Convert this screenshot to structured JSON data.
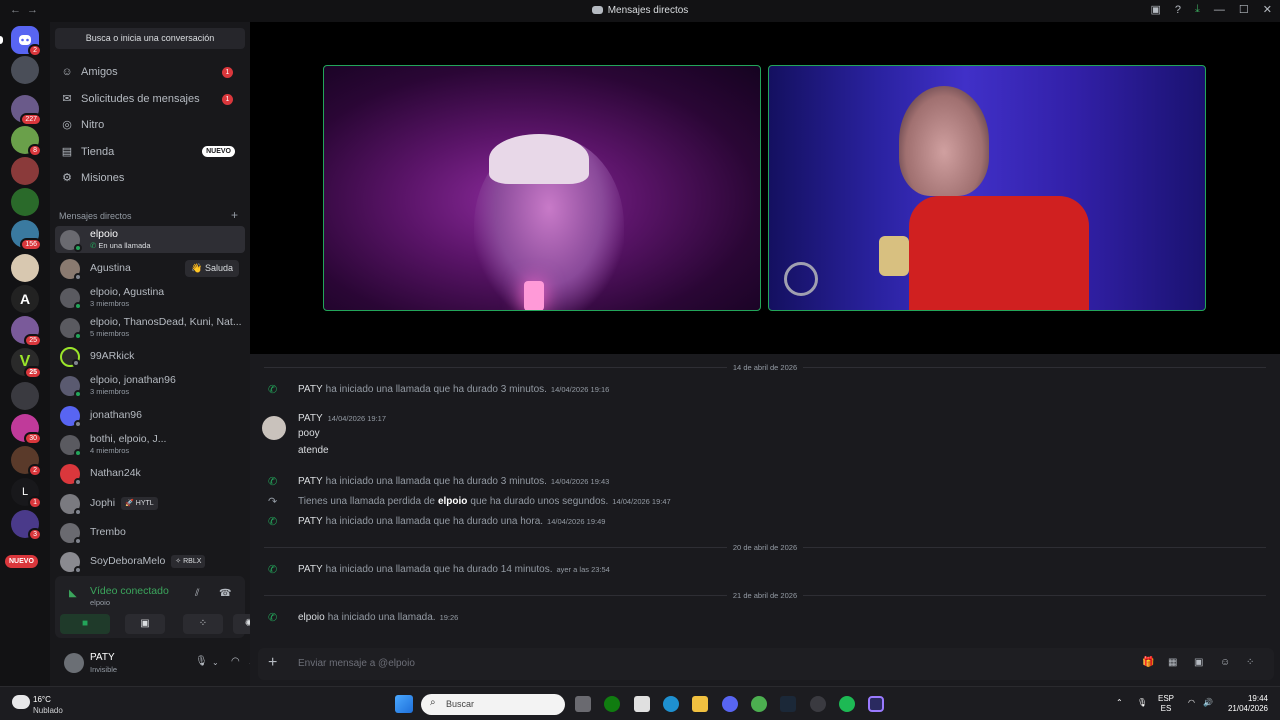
{
  "window": {
    "title": "Mensajes directos"
  },
  "search": {
    "label": "Busca o inicia una conversación"
  },
  "guild_badges": [
    "2",
    "227",
    "8",
    "156",
    "25",
    "25",
    "30",
    "2",
    "1",
    "3"
  ],
  "guild_new_label": "NUEVO",
  "nav": {
    "friends": {
      "label": "Amigos",
      "badge": "1"
    },
    "requests": {
      "label": "Solicitudes de mensajes",
      "badge": "1"
    },
    "nitro": {
      "label": "Nitro"
    },
    "shop": {
      "label": "Tienda",
      "badge": "NUEVO"
    },
    "quests": {
      "label": "Misiones"
    }
  },
  "dm_header": "Mensajes directos",
  "dms": [
    {
      "name": "elpoio",
      "sub": "En una llamada",
      "active": true
    },
    {
      "name": "Agustina",
      "sub": "",
      "action": "👋 Saluda"
    },
    {
      "name": "elpoio, Agustina",
      "sub": "3 miembros"
    },
    {
      "name": "elpoio, ThanosDead, Kuni, Nat...",
      "sub": "5 miembros"
    },
    {
      "name": "99ARkick",
      "sub": ""
    },
    {
      "name": "elpoio, jonathan96",
      "sub": "3 miembros"
    },
    {
      "name": "jonathan96",
      "sub": ""
    },
    {
      "name": "bothi, elpoio, J...",
      "sub": "4 miembros"
    },
    {
      "name": "Nathan24k",
      "sub": ""
    },
    {
      "name": "Jophi",
      "sub": "",
      "tag": "🚀 HYTL"
    },
    {
      "name": "Trembo",
      "sub": ""
    },
    {
      "name": "SoyDeboraMelo",
      "sub": "",
      "tag": "✧ RBLX"
    }
  ],
  "voice": {
    "status": "Vídeo conectado",
    "channel": "elpoio"
  },
  "user": {
    "name": "PATY",
    "status": "Invisible"
  },
  "chat": {
    "dividers": [
      "14 de abril de 2026",
      "20 de abril de 2026",
      "21 de abril de 2026"
    ],
    "events": [
      {
        "who": "PATY",
        "text": "ha iniciado una llamada que ha durado 3 minutos.",
        "ts": "14/04/2026 19:16"
      },
      {
        "who": "PATY",
        "text": "ha iniciado una llamada que ha durado 3 minutos.",
        "ts": "14/04/2026 19:43"
      },
      {
        "pre": "Tienes una llamada perdida de",
        "who": "elpoio",
        "text": "que ha durado unos segundos.",
        "ts": "14/04/2026 19:47"
      },
      {
        "who": "PATY",
        "text": "ha iniciado una llamada que ha durado una hora.",
        "ts": "14/04/2026 19:49"
      },
      {
        "who": "PATY",
        "text": "ha iniciado una llamada que ha durado 14 minutos.",
        "ts": "ayer a las 23:54"
      },
      {
        "who": "elpoio",
        "text": "ha iniciado una llamada.",
        "ts": "19:26"
      }
    ],
    "message": {
      "author": "PATY",
      "ts": "14/04/2026 19:17",
      "lines": [
        "pooy",
        "atende"
      ]
    }
  },
  "composer": {
    "placeholder": "Enviar mensaje a @elpoio"
  },
  "taskbar": {
    "weather_temp": "16°C",
    "weather_desc": "Nublado",
    "search": "Buscar",
    "lang_top": "ESP",
    "lang_bottom": "ES",
    "time": "19:44",
    "date": "21/04/2026"
  },
  "colors": {
    "accent_green": "#23a55a",
    "badge_red": "#da373c",
    "blurple": "#5865f2"
  }
}
